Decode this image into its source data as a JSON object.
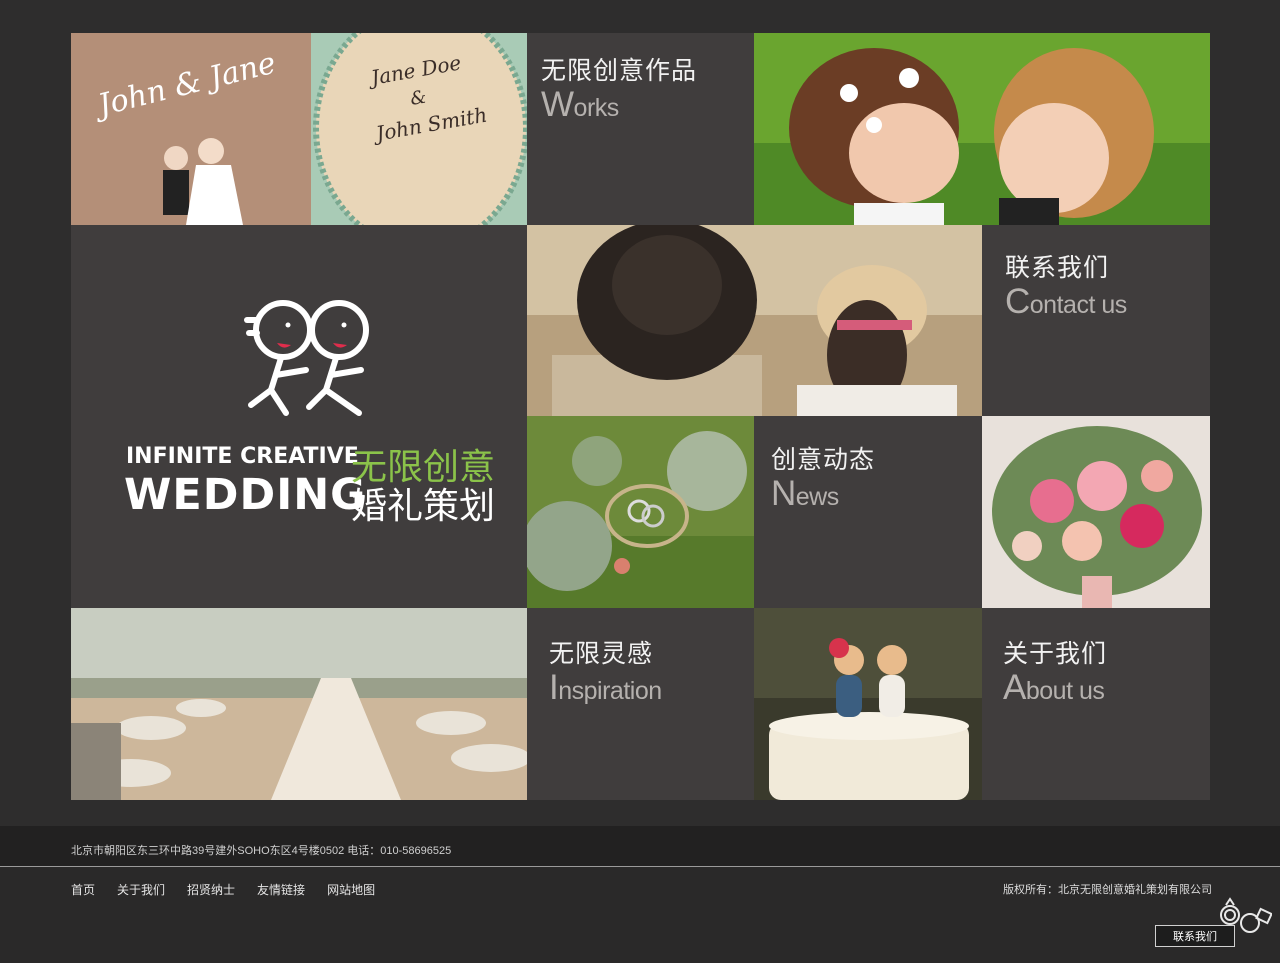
{
  "tiles": {
    "works": {
      "cn": "无限创意作品",
      "en_cap": "W",
      "en_rest": "orks"
    },
    "contact": {
      "cn": "联系我们",
      "en_cap": "C",
      "en_rest": "ontact us"
    },
    "news": {
      "cn": "创意动态",
      "en_cap": "N",
      "en_rest": "ews"
    },
    "inspiration": {
      "cn": "无限灵感",
      "en_cap": "I",
      "en_rest": "nspiration"
    },
    "about": {
      "cn": "关于我们",
      "en_cap": "A",
      "en_rest": "bout us"
    }
  },
  "logo": {
    "en_line1": "INFINITE CREATIVE",
    "en_line2": "WEDDING",
    "cn_line1": "无限创意",
    "cn_line2": "婚礼策划"
  },
  "photos": {
    "invitation": {
      "line1": "John & Jane",
      "line2": "Jane Doe",
      "line3": "&",
      "line4": "John Smith"
    }
  },
  "footer": {
    "address": "北京市朝阳区东三环中路39号建外SOHO东区4号楼0502 电话：010-58696525",
    "nav": [
      "首页",
      "关于我们",
      "招贤纳士",
      "友情链接",
      "网站地图"
    ],
    "copyright": "版权所有：北京无限创意婚礼策划有限公司",
    "contact_button": "联系我们"
  },
  "colors": {
    "accent_green": "#8bc34a",
    "tile_gray": "#403d3d",
    "page_bg": "#2e2d2d"
  }
}
